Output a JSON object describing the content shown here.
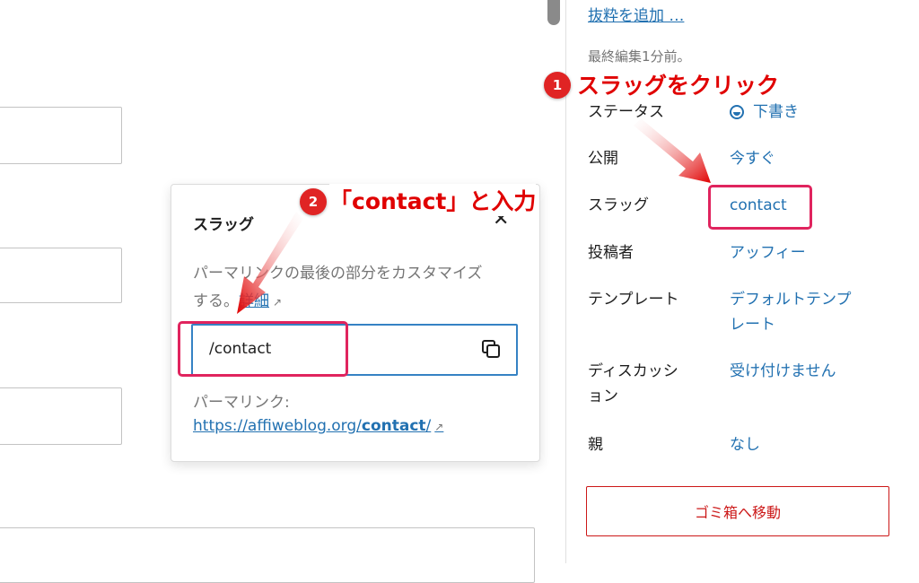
{
  "sidebar": {
    "excerpt_link": "抜粋を追加 …",
    "last_edited": "最終編集1分前。",
    "rows": [
      {
        "label": "ステータス",
        "value": "下書き"
      },
      {
        "label": "公開",
        "value": "今すぐ"
      },
      {
        "label": "スラッグ",
        "value": "contact"
      },
      {
        "label": "投稿者",
        "value": "アッフィー"
      },
      {
        "label": "テンプレート",
        "value_line1": "デフォルトテンプ",
        "value_line2": "レート"
      },
      {
        "label_line1": "ディスカッシ",
        "label_line2": "ョン",
        "value": "受け付けません"
      },
      {
        "label": "親",
        "value": "なし"
      }
    ],
    "trash_button": "ゴミ箱へ移動"
  },
  "popover": {
    "title": "スラッグ",
    "close_icon": "close-icon",
    "desc_line1": "パーマリンクの最後の部分をカスタマイズ",
    "desc_line2_prefix": "する。",
    "desc_more_link": "詳細",
    "slug_value": "/contact",
    "copy_icon": "copy-icon",
    "permalink_label": "パーマリンク:",
    "permalink_prefix": "https://affiweblog.org/",
    "permalink_slug": "contact",
    "permalink_suffix": "/"
  },
  "annotations": {
    "step1_number": "1",
    "step1_text": "スラッグをクリック",
    "step2_number": "2",
    "step2_text": "「contact」と入力",
    "color": "#e00000",
    "highlight_color": "#e0245e"
  },
  "colors": {
    "link": "#2271b1",
    "danger": "#cc1818",
    "focus": "#3582c4"
  }
}
